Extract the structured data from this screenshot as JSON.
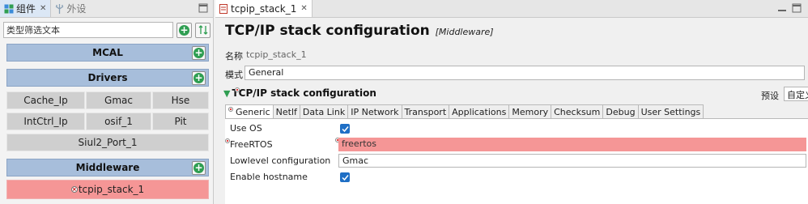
{
  "left_panel": {
    "tabs": [
      {
        "label": "组件",
        "active": true,
        "closable": true
      },
      {
        "label": "外设",
        "active": false
      }
    ],
    "filter": {
      "placeholder": "类型筛选文本"
    },
    "categories": [
      {
        "label": "MCAL"
      },
      {
        "label": "Drivers"
      },
      {
        "label": "Middleware"
      }
    ],
    "drivers": [
      "Cache_Ip",
      "Gmac",
      "Hse",
      "IntCtrl_Ip",
      "osif_1",
      "Pit",
      "Siul2_Port_1"
    ],
    "middleware": [
      {
        "label": "tcpip_stack_1",
        "error": true
      }
    ]
  },
  "editor": {
    "tab": {
      "label": "tcpip_stack_1",
      "closable": true
    },
    "title": "TCP/IP stack configuration",
    "subtitle": "[Middleware]",
    "name_label": "名称",
    "name_value": "tcpip_stack_1",
    "mode_label": "模式",
    "mode_value": "General",
    "section": {
      "title": "TCP/IP stack configuration",
      "preset_label": "预设",
      "preset_value": "自定义"
    },
    "prop_tabs": [
      "Generic",
      "Netlf",
      "Data Link",
      "IP Network",
      "Transport",
      "Applications",
      "Memory",
      "Checksum",
      "Debug",
      "User Settings"
    ],
    "active_tab_index": 0,
    "properties": [
      {
        "label": "Use OS",
        "type": "checkbox",
        "checked": true
      },
      {
        "label": "FreeRTOS",
        "type": "text",
        "value": "freertos",
        "error": true
      },
      {
        "label": "Lowlevel configuration",
        "type": "text",
        "value": "Gmac"
      },
      {
        "label": "Enable hostname",
        "type": "checkbox",
        "checked": true
      }
    ]
  },
  "colors": {
    "category_bg": "#a7bedb",
    "item_bg": "#cfcfcf",
    "error_bg": "#f59696",
    "add_icon": "#2f9e52",
    "checkbox": "#1f6fc5"
  }
}
